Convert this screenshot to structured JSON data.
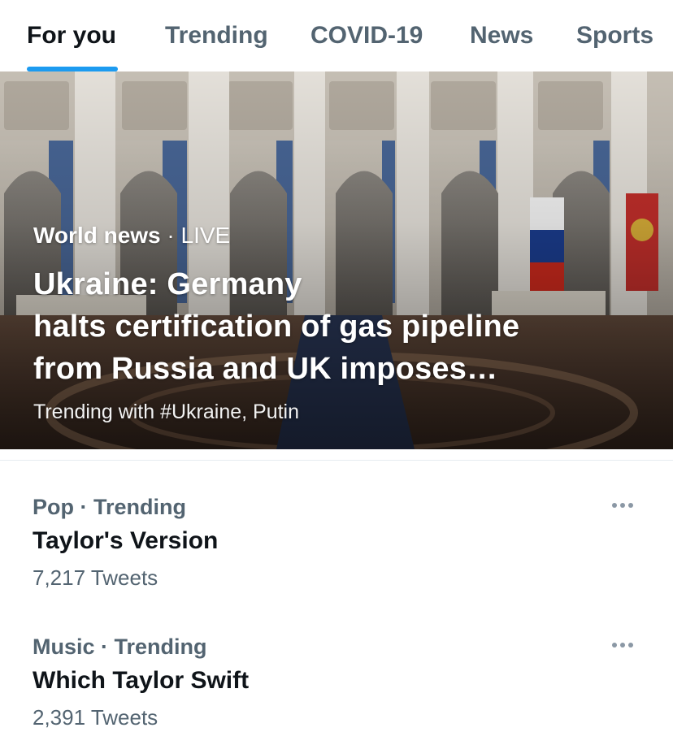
{
  "tabs": [
    {
      "label": "For you",
      "active": true
    },
    {
      "label": "Trending",
      "active": false
    },
    {
      "label": "COVID-19",
      "active": false
    },
    {
      "label": "News",
      "active": false
    },
    {
      "label": "Sports",
      "active": false
    }
  ],
  "hero": {
    "category": "World news",
    "separator": " · ",
    "status": "LIVE",
    "headline_lines": [
      "Ukraine: Germany",
      "halts certification of gas pipeline",
      "from Russia and UK imposes…"
    ],
    "subtext": "Trending with #Ukraine, Putin",
    "image_description_icon": "photo-image"
  },
  "trends": [
    {
      "category": "Pop",
      "separator": " · ",
      "type": "Trending",
      "title": "Taylor's Version",
      "count": "7,217 Tweets",
      "more_icon": "more-horizontal-icon"
    },
    {
      "category": "Music",
      "separator": " · ",
      "type": "Trending",
      "title": "Which Taylor Swift",
      "count": "2,391 Tweets",
      "more_icon": "more-horizontal-icon"
    }
  ],
  "colors": {
    "accent": "#1d9bf0",
    "text_primary": "#0f1419",
    "text_secondary": "#536471"
  }
}
